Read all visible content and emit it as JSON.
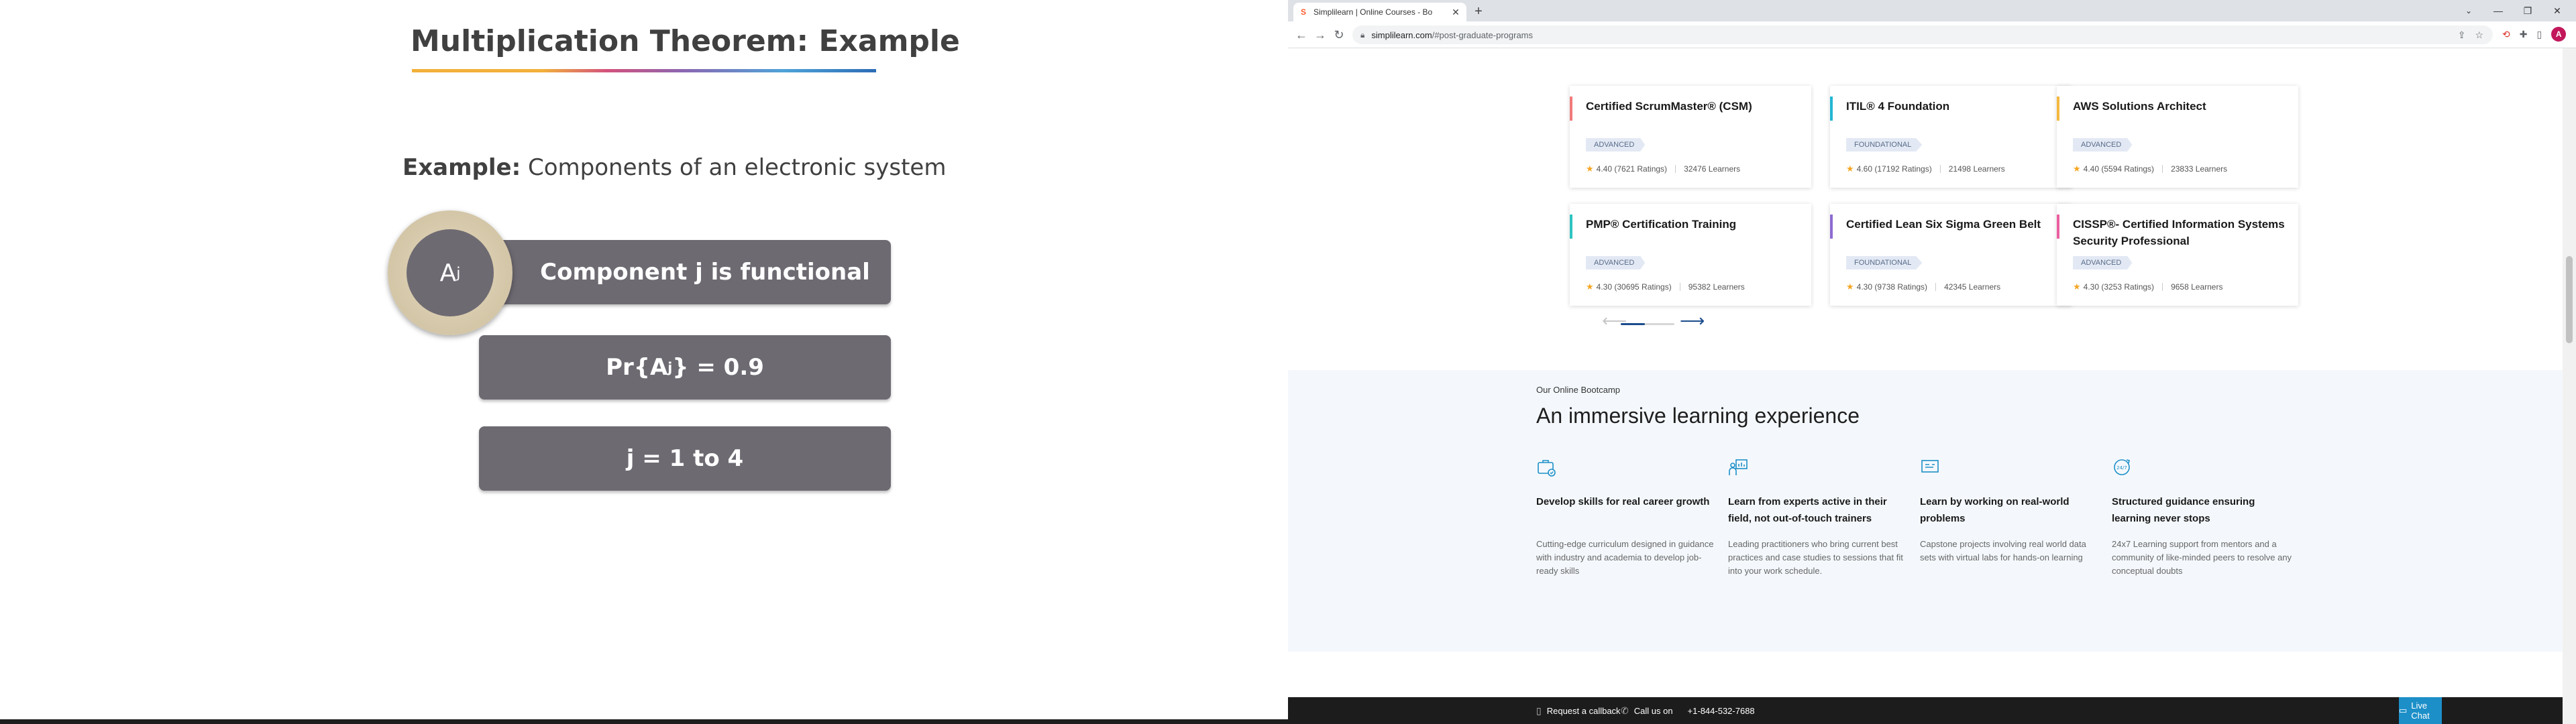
{
  "slide": {
    "title": "Multiplication Theorem: Example",
    "example_label": "Example:",
    "example_text": "Components of an electronic system",
    "circle_symbol": "A",
    "circle_sub": "j",
    "box1": "Component j is functional",
    "box2_pre": "Pr{A",
    "box2_sub": "j",
    "box2_post": " } = 0.9",
    "box3": "j = 1 to 4",
    "colors": {
      "bar": "#6e6a72",
      "text": "#404040",
      "ring": "#d9cdb0"
    }
  },
  "browser": {
    "tab_title": "Simplilearn | Online Courses - Bo",
    "url_host": "simplilearn.com",
    "url_path": "/#post-graduate-programs",
    "profile_initial": "A",
    "icons": {
      "back": "back-arrow-icon",
      "forward": "forward-arrow-icon",
      "reload": "reload-icon",
      "lock": "lock-icon",
      "share": "share-icon",
      "star": "bookmark-star-icon",
      "extensions": "puzzle-icon",
      "sidebar": "side-panel-icon"
    }
  },
  "courses": [
    {
      "title": "Certified ScrumMaster® (CSM)",
      "level": "ADVANCED",
      "rating": "4.40 (7621 Ratings)",
      "learners": "32476 Learners",
      "accent": "#f27a7a"
    },
    {
      "title": "ITIL® 4 Foundation",
      "level": "FOUNDATIONAL",
      "rating": "4.60 (17192 Ratings)",
      "learners": "21498 Learners",
      "accent": "#23b5d3"
    },
    {
      "title": "AWS Solutions Architect",
      "level": "ADVANCED",
      "rating": "4.40 (5594 Ratings)",
      "learners": "23833 Learners",
      "accent": "#f5b941"
    },
    {
      "title": "PMP® Certification Training",
      "level": "ADVANCED",
      "rating": "4.30 (30695 Ratings)",
      "learners": "95382 Learners",
      "accent": "#2ec4c1"
    },
    {
      "title": "Certified Lean Six Sigma Green Belt",
      "level": "FOUNDATIONAL",
      "rating": "4.30 (9738 Ratings)",
      "learners": "42345 Learners",
      "accent": "#8e6bd1"
    },
    {
      "title": "CISSP®- Certified Information Systems Security Professional",
      "level": "ADVANCED",
      "rating": "4.30 (3253 Ratings)",
      "learners": "9658 Learners",
      "accent": "#ec5fa1"
    }
  ],
  "carousel": {
    "current": 1,
    "total": 2
  },
  "bootcamp": {
    "eyebrow": "Our Online Bootcamp",
    "title": "An immersive learning experience",
    "features": [
      {
        "icon": "briefcase-icon",
        "heading": "Develop skills for real career growth",
        "body": "Cutting-edge curriculum designed in guidance with industry and academia to develop job-ready skills"
      },
      {
        "icon": "presenter-icon",
        "heading": "Learn from experts active in their field, not out-of-touch trainers",
        "body": "Leading practitioners who bring current best practices and case studies to sessions that fit into your work schedule."
      },
      {
        "icon": "project-screen-icon",
        "heading": "Learn by working on real-world problems",
        "body": "Capstone projects involving real world data sets with virtual labs for hands-on learning"
      },
      {
        "icon": "24-7-support-icon",
        "heading": "Structured guidance ensuring learning never stops",
        "body": "24x7 Learning support from mentors and a community of like-minded peers to resolve any conceptual doubts"
      }
    ]
  },
  "bottom_bar": {
    "callback": "Request a callback",
    "call_label": "Call us on",
    "phone": "+1-844-532-7688",
    "live_chat": "Live Chat",
    "live_chat_color": "#1d8fc8"
  }
}
